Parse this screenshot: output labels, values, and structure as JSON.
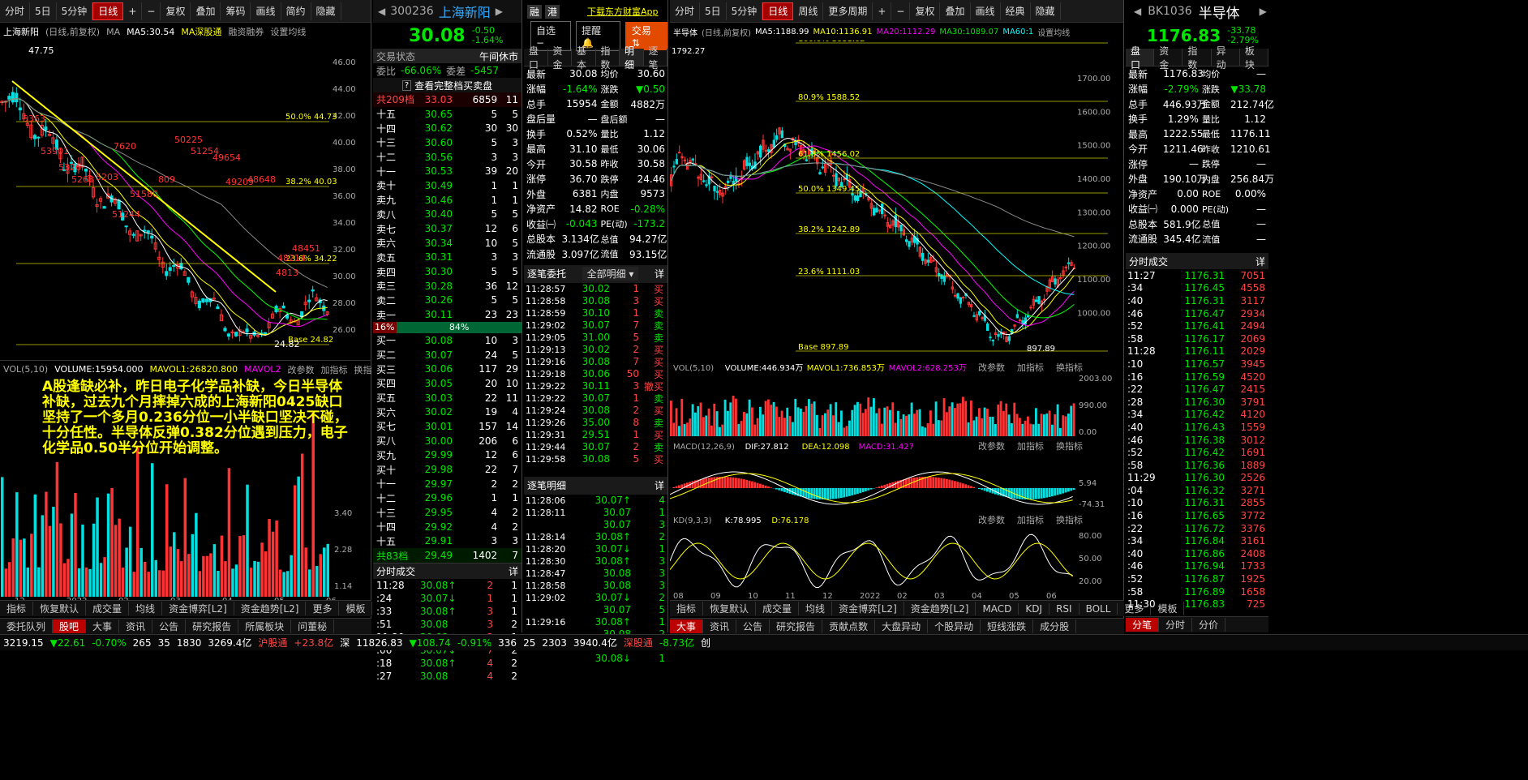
{
  "left_toolbar": [
    "分时",
    "5日",
    "5分钟",
    "日线",
    "+",
    "−",
    "复权",
    "叠加",
    "筹码",
    "画线",
    "简约",
    "隐藏"
  ],
  "left_chart": {
    "title": "上海新阳",
    "mode": "(日线,前复权)",
    "ma_label": "MA",
    "ma5": "MA5:30.54",
    "extra": "MA深股通",
    "margin": "融资融券",
    "settings": "设置均线",
    "price_ticks": [
      "46.00",
      "44.00",
      "42.00",
      "40.00",
      "38.00",
      "36.00",
      "34.00",
      "32.00",
      "30.00",
      "28.00",
      "26.00"
    ],
    "fib": [
      "50.0% 44.73",
      "38.2% 40.03",
      "23.6% 34.22",
      "Base 24.82"
    ],
    "annotations": [
      "47.75",
      "5363",
      "53901",
      "7620",
      "50225",
      "51254",
      "49654",
      "5326",
      "5268",
      "5203",
      "809",
      "51580",
      "49209",
      "48648",
      "51244",
      "48451",
      "48214",
      "4813",
      "24.82"
    ],
    "date_ticks": [
      "12",
      "2022",
      "02",
      "03",
      "04",
      "05",
      "06"
    ]
  },
  "vol_panel": {
    "label": "VOL(5,10)",
    "vol": "VOLUME:15954.000",
    "mavol1": "MAVOL1:26820.800",
    "mavol2": "MAVOL2",
    "btns": [
      "改参数",
      "加指标",
      "换指标"
    ],
    "ticks": [
      "3.40",
      "2.28",
      "1.14"
    ]
  },
  "note": "A股逢缺必补，昨日电子化学品补缺，今日半导体补缺，过去九个月摔掉六成的上海新阳0425缺口坚持了一个多月0.236分位一小半缺口坚决不碰，十分任性。半导体反弹0.382分位遇到压力，电子化学品0.50半分位开始调整。",
  "left_bottom_tabs": [
    "指标",
    "恢复默认",
    "成交量",
    "均线",
    "资金博弈[L2]",
    "资金趋势[L2]",
    "更多",
    "模板"
  ],
  "bottom_tabs_left": [
    "委托队列",
    "股吧",
    "大事",
    "资讯",
    "公告",
    "研究报告",
    "所属板块",
    "问董秘"
  ],
  "stock": {
    "code": "300236",
    "name": "上海新阳",
    "price": "30.08",
    "chg": "-0.50",
    "pct": "-1.64%",
    "tags": [
      "融",
      "港"
    ],
    "download": "下载东方财富App",
    "btn_choice": "自选",
    "btn_alert": "提醒",
    "btn_trade": "交易"
  },
  "order_book": {
    "status_label": "交易状态",
    "status": "午间休市",
    "ratio_label": "委比",
    "ratio": "-66.06%",
    "diff_label": "委差",
    "diff": "-5457",
    "link": "查看完整档买卖盘",
    "total_sell": "共209档",
    "sell_head_price": "33.03",
    "sell_head_vol": "6859",
    "sell_head_n": "11",
    "sells": [
      [
        "十五",
        "30.65",
        "5",
        "5"
      ],
      [
        "十四",
        "30.62",
        "30",
        "30"
      ],
      [
        "十三",
        "30.60",
        "5",
        "3"
      ],
      [
        "十二",
        "30.56",
        "3",
        "3"
      ],
      [
        "十一",
        "30.53",
        "39",
        "20"
      ],
      [
        "卖十",
        "30.49",
        "1",
        "1"
      ],
      [
        "卖九",
        "30.46",
        "1",
        "1"
      ],
      [
        "卖八",
        "30.40",
        "5",
        "5"
      ],
      [
        "卖七",
        "30.37",
        "12",
        "6"
      ],
      [
        "卖六",
        "30.34",
        "10",
        "5"
      ],
      [
        "卖五",
        "30.31",
        "3",
        "3"
      ],
      [
        "卖四",
        "30.30",
        "5",
        "5"
      ],
      [
        "卖三",
        "30.28",
        "36",
        "12"
      ],
      [
        "卖二",
        "30.26",
        "5",
        "5"
      ],
      [
        "卖一",
        "30.11",
        "23",
        "23"
      ]
    ],
    "bar_left": "16%",
    "bar_right": "84%",
    "buys": [
      [
        "买一",
        "30.08",
        "10",
        "3"
      ],
      [
        "买二",
        "30.07",
        "24",
        "5"
      ],
      [
        "买三",
        "30.06",
        "117",
        "29"
      ],
      [
        "买四",
        "30.05",
        "20",
        "10"
      ],
      [
        "买五",
        "30.03",
        "22",
        "11"
      ],
      [
        "买六",
        "30.02",
        "19",
        "4"
      ],
      [
        "买七",
        "30.01",
        "157",
        "14"
      ],
      [
        "买八",
        "30.00",
        "206",
        "6"
      ],
      [
        "买九",
        "29.99",
        "12",
        "6"
      ],
      [
        "买十",
        "29.98",
        "22",
        "7"
      ],
      [
        "十一",
        "29.97",
        "2",
        "2"
      ],
      [
        "十二",
        "29.96",
        "1",
        "1"
      ],
      [
        "十三",
        "29.95",
        "4",
        "2"
      ],
      [
        "十四",
        "29.92",
        "4",
        "2"
      ],
      [
        "十五",
        "29.91",
        "3",
        "3"
      ]
    ],
    "total_buy": "共83档",
    "buy_tail_price": "29.49",
    "buy_tail_vol": "1402",
    "buy_tail_n": "7"
  },
  "ob_ticks": {
    "title": "分时成交",
    "detail": "详",
    "rows": [
      [
        "11:28",
        "30.08↑",
        "2",
        "1"
      ],
      [
        ":24",
        "30.07↓",
        "1",
        "1"
      ],
      [
        ":33",
        "30.08↑",
        "3",
        "1"
      ],
      [
        ":51",
        "30.08",
        "3",
        "2"
      ],
      [
        "11:29",
        "30.08",
        "3",
        "1"
      ],
      [
        ":06",
        "30.07↓",
        "7",
        "2"
      ],
      [
        ":18",
        "30.08↑",
        "4",
        "2"
      ],
      [
        ":27",
        "30.08",
        "4",
        "2"
      ]
    ]
  },
  "detail_tabs": [
    "盘口",
    "资金",
    "基本",
    "指数",
    "明细",
    "逐笔"
  ],
  "detail": {
    "rows": [
      [
        "最新",
        "30.08",
        "均价",
        "30.60"
      ],
      [
        "涨幅",
        "-1.64%",
        "涨跌",
        "▼0.50"
      ],
      [
        "总手",
        "15954",
        "金额",
        "4882万"
      ],
      [
        "盘后量",
        "—",
        "盘后额",
        "—"
      ],
      [
        "换手",
        "0.52%",
        "量比",
        "1.12"
      ],
      [
        "最高",
        "31.10",
        "最低",
        "30.06"
      ],
      [
        "今开",
        "30.58",
        "昨收",
        "30.58"
      ],
      [
        "涨停",
        "36.70",
        "跌停",
        "24.46"
      ],
      [
        "外盘",
        "6381",
        "内盘",
        "9573"
      ],
      [
        "净资产",
        "14.82",
        "ROE",
        "-0.28%"
      ],
      [
        "收益㈠",
        "-0.043",
        "PE(动)",
        "-173.2"
      ],
      [
        "总股本",
        "3.134亿",
        "总值",
        "94.27亿"
      ],
      [
        "流通股",
        "3.097亿",
        "流值",
        "93.15亿"
      ]
    ]
  },
  "trades_title": "逐笔委托",
  "trades_filter": "全部明细",
  "trades": [
    [
      "11:28:57",
      "30.02",
      "1",
      "买"
    ],
    [
      "11:28:58",
      "30.08",
      "3",
      "买"
    ],
    [
      "11:28:59",
      "30.10",
      "1",
      "卖"
    ],
    [
      "11:29:02",
      "30.07",
      "7",
      "卖"
    ],
    [
      "11:29:05",
      "31.00",
      "5",
      "卖"
    ],
    [
      "11:29:13",
      "30.02",
      "2",
      "买"
    ],
    [
      "11:29:16",
      "30.08",
      "7",
      "买"
    ],
    [
      "11:29:18",
      "30.06",
      "50",
      "买"
    ],
    [
      "11:29:22",
      "30.11",
      "3",
      "撤买"
    ],
    [
      "11:29:22",
      "30.07",
      "1",
      "卖"
    ],
    [
      "11:29:24",
      "30.08",
      "2",
      "买"
    ],
    [
      "11:29:26",
      "35.00",
      "8",
      "卖"
    ],
    [
      "11:29:31",
      "29.51",
      "1",
      "买"
    ],
    [
      "11:29:44",
      "30.07",
      "2",
      "卖"
    ],
    [
      "11:29:58",
      "30.08",
      "5",
      "买"
    ]
  ],
  "mingxi_title": "逐笔明细",
  "mingxi": [
    [
      "11:28:06",
      "30.07↑",
      "4"
    ],
    [
      "11:28:11",
      "30.07",
      "1"
    ],
    [
      "",
      "30.07",
      "3"
    ],
    [
      "11:28:14",
      "30.08↑",
      "2"
    ],
    [
      "11:28:20",
      "30.07↓",
      "1"
    ],
    [
      "11:28:30",
      "30.08↑",
      "3"
    ],
    [
      "11:28:47",
      "30.08",
      "3"
    ],
    [
      "11:28:58",
      "30.08",
      "3"
    ],
    [
      "11:29:02",
      "30.07↓",
      "2"
    ],
    [
      "",
      "30.07",
      "5"
    ],
    [
      "11:29:16",
      "30.08↑",
      "1"
    ],
    [
      "",
      "30.08",
      "2"
    ],
    [
      "11:29:22",
      "30.11↑",
      "3"
    ],
    [
      "",
      "30.08↓",
      "1"
    ]
  ],
  "right_toolbar": [
    "分时",
    "5日",
    "5分钟",
    "日线",
    "周线",
    "更多周期",
    "+",
    "−",
    "复权",
    "叠加",
    "画线",
    "经典",
    "隐藏"
  ],
  "right_chart": {
    "title": "半导体",
    "mode": "(日线,前复权)",
    "ma_label": "MA",
    "ma5": "MA5:1188.99",
    "ma10": "MA10:1136.91",
    "ma20": "MA20:1112.29",
    "ma30": "MA30:1089.07",
    "ma60": "MA60:1",
    "settings": "设置均线",
    "price_ticks": [
      "1700.00",
      "1600.00",
      "1500.00",
      "1400.00",
      "1300.00",
      "1200.00",
      "1100.00",
      "1000.00"
    ],
    "fib": [
      "100.0% 1681.02",
      "80.9% 1588.52",
      "61.8% 1456.02",
      "50.0% 1349.45",
      "38.2% 1242.89",
      "23.6% 1111.03",
      "Base 897.89"
    ],
    "annotations": [
      "1792.27",
      "897.89"
    ],
    "vol": "VOL(5,10)",
    "vol_v": "VOLUME:446.934万",
    "vol_m1": "MAVOL1:736.853万",
    "vol_m2": "MAVOL2:628.253万",
    "vol_ticks": [
      "2003.00",
      "990.00",
      "0.00"
    ],
    "macd": "MACD(12,26,9)",
    "dif": "DIF:27.812",
    "dea": "DEA:12.098",
    "macdv": "MACD:31.427",
    "macd_ticks": [
      "5.94",
      "-74.31"
    ],
    "kd": "KD(9,3,3)",
    "k": "K:78.995",
    "d": "D:76.178",
    "kd_ticks": [
      "80.00",
      "50.00",
      "20.00"
    ],
    "btns": [
      "改参数",
      "加指标",
      "换指标"
    ],
    "date_ticks": [
      "08",
      "09",
      "10",
      "11",
      "12",
      "2022",
      "02",
      "03",
      "04",
      "05",
      "06"
    ]
  },
  "right_bottom_tabs": [
    "指标",
    "恢复默认",
    "成交量",
    "均线",
    "资金博弈[L2]",
    "资金趋势[L2]",
    "MACD",
    "KDJ",
    "RSI",
    "BOLL",
    "更多",
    "模板"
  ],
  "bottom_tabs_right": [
    "大事",
    "资讯",
    "公告",
    "研究报告",
    "贡献点数",
    "大盘异动",
    "个股异动",
    "短线涨跌",
    "成分股"
  ],
  "index": {
    "code": "BK1036",
    "name": "半导体",
    "price": "1176.83",
    "chg": "-33.78",
    "pct": "-2.79%",
    "tabs": [
      "盘口",
      "资金",
      "指数",
      "异动",
      "板块"
    ],
    "rows": [
      [
        "最新",
        "1176.83",
        "均价",
        "—"
      ],
      [
        "涨幅",
        "-2.79%",
        "涨跌",
        "▼33.78"
      ],
      [
        "总手",
        "446.93万",
        "金额",
        "212.74亿"
      ],
      [
        "换手",
        "1.29%",
        "量比",
        "1.12"
      ],
      [
        "最高",
        "1222.55",
        "最低",
        "1176.11"
      ],
      [
        "今开",
        "1211.46",
        "昨收",
        "1210.61"
      ],
      [
        "涨停",
        "—",
        "跌停",
        "—"
      ],
      [
        "外盘",
        "190.10万",
        "内盘",
        "256.84万"
      ],
      [
        "净资产",
        "0.00",
        "ROE",
        "0.00%"
      ],
      [
        "收益㈠",
        "0.000",
        "PE(动)",
        "—"
      ],
      [
        "总股本",
        "581.9亿",
        "总值",
        "—"
      ],
      [
        "流通股",
        "345.4亿",
        "流值",
        "—"
      ]
    ],
    "ticks_title": "分时成交",
    "ticks": [
      [
        "11:27",
        "1176.31",
        "7051"
      ],
      [
        ":34",
        "1176.45",
        "4558"
      ],
      [
        ":40",
        "1176.31",
        "3117"
      ],
      [
        ":46",
        "1176.47",
        "2934"
      ],
      [
        ":52",
        "1176.41",
        "2494"
      ],
      [
        ":58",
        "1176.17",
        "2069"
      ],
      [
        "11:28",
        "1176.11",
        "2029"
      ],
      [
        ":10",
        "1176.57",
        "3945"
      ],
      [
        ":16",
        "1176.59",
        "4520"
      ],
      [
        ":22",
        "1176.47",
        "2415"
      ],
      [
        ":28",
        "1176.30",
        "3791"
      ],
      [
        ":34",
        "1176.42",
        "4120"
      ],
      [
        ":40",
        "1176.43",
        "1559"
      ],
      [
        ":46",
        "1176.38",
        "3012"
      ],
      [
        ":52",
        "1176.42",
        "1691"
      ],
      [
        ":58",
        "1176.36",
        "1889"
      ],
      [
        "11:29",
        "1176.30",
        "2526"
      ],
      [
        ":04",
        "1176.32",
        "3271"
      ],
      [
        ":10",
        "1176.31",
        "2855"
      ],
      [
        ":16",
        "1176.65",
        "3772"
      ],
      [
        ":22",
        "1176.72",
        "3376"
      ],
      [
        ":34",
        "1176.84",
        "3161"
      ],
      [
        ":40",
        "1176.86",
        "2408"
      ],
      [
        ":46",
        "1176.94",
        "1733"
      ],
      [
        ":52",
        "1176.87",
        "1925"
      ],
      [
        ":58",
        "1176.89",
        "1658"
      ],
      [
        "11:30",
        "1176.83",
        "725"
      ]
    ],
    "bottom_tabs": [
      "分笔",
      "分时",
      "分价"
    ]
  },
  "ticker": {
    "items": [
      "3219.15",
      "▼22.61",
      "-0.70%",
      "265",
      "35",
      "1830",
      "3269.4亿",
      "沪股通",
      "+23.8亿",
      "深",
      "11826.83",
      "▼108.74",
      "-0.91%",
      "336",
      "25",
      "2303",
      "3940.4亿",
      "深股通",
      "-8.73亿",
      "创"
    ],
    "items2": [
      "19.15",
      "▼22.61",
      "-0.70%",
      "265",
      "35",
      "1830",
      "3269.4亿",
      "沪股通",
      "+23.8亿",
      "深",
      "11826.83",
      "▼108.74",
      "-0.91%",
      "336",
      "25",
      "2303",
      "3940.4亿",
      "深股通"
    ]
  }
}
